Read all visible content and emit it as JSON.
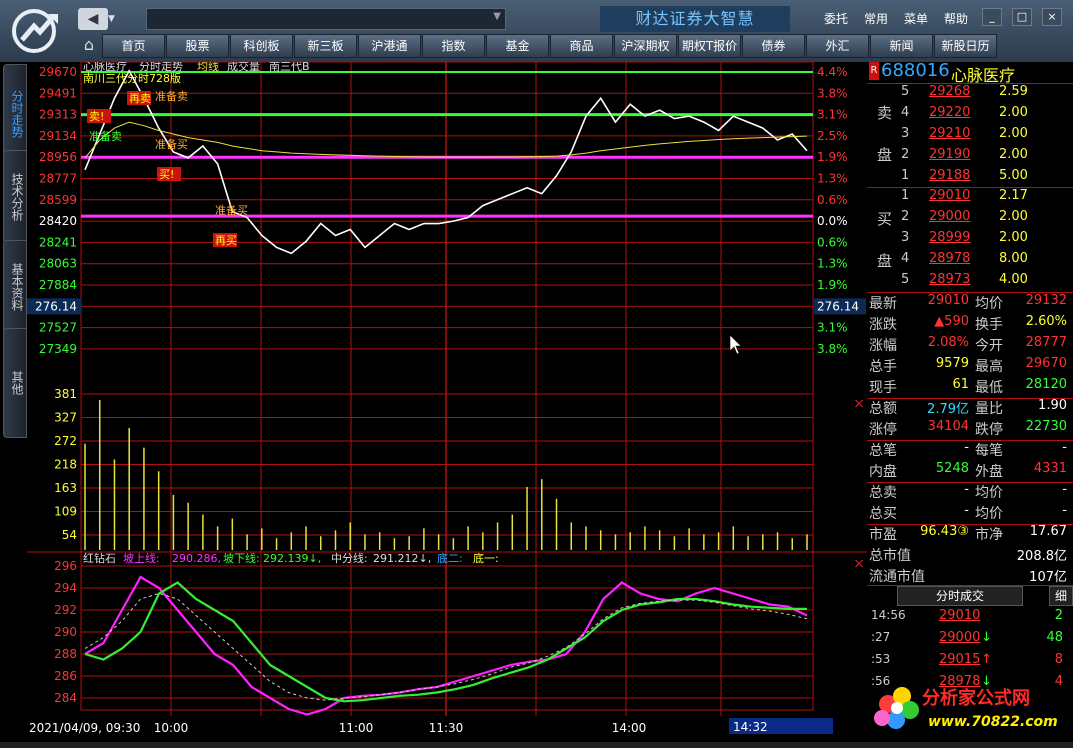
{
  "app": {
    "name": "财达证券大智慧",
    "menu": [
      "委托",
      "常用",
      "菜单",
      "帮助"
    ],
    "nav_tabs": [
      "首页",
      "股票",
      "科创板",
      "新三板",
      "沪港通",
      "指数",
      "基金",
      "商品",
      "沪深期权",
      "期权T报价",
      "债券",
      "外汇",
      "新闻",
      "新股日历"
    ],
    "window_buttons": [
      "_",
      "□",
      "×"
    ],
    "back_arrow": "◀",
    "home_icon": "⌂"
  },
  "left_tabs": [
    "分时走势",
    "技术分析",
    "基本资料",
    "其他"
  ],
  "chart": {
    "header": [
      "心脉医疗",
      "分时走势",
      "均线",
      "成交量",
      "南三代B"
    ],
    "legend_line2": "南川三代分时728版",
    "price_ticks": [
      "29670",
      "29491",
      "29313",
      "29134",
      "28956",
      "28777",
      "28599",
      "28420",
      "28241",
      "28063",
      "27884",
      "276.14",
      "27527",
      "27349"
    ],
    "pct_ticks": [
      "4.4%",
      "3.8%",
      "3.1%",
      "2.5%",
      "1.9%",
      "1.3%",
      "0.6%",
      "0.0%",
      "0.6%",
      "1.3%",
      "1.9%",
      "276.14",
      "3.1%",
      "3.8%"
    ],
    "volume_ticks": [
      "381",
      "327",
      "272",
      "218",
      "163",
      "109",
      "54"
    ],
    "signals": [
      "卖!",
      "准备卖",
      "再卖",
      "准备卖",
      "准备买",
      "买!",
      "准备买",
      "再买"
    ],
    "indicator_header": [
      "红钻石",
      "坡上线:",
      "290.286,",
      "坡下线:",
      "292.139↓,",
      "中分线:",
      "291.212↓,",
      "底二:",
      "底一:"
    ],
    "indicator_ticks": [
      "296",
      "294",
      "292",
      "290",
      "288",
      "286",
      "284"
    ],
    "time_labels": [
      "2021/04/09, 09:30",
      "10:00",
      "11:00",
      "11:30",
      "14:00"
    ],
    "time_cursor": "14:32",
    "cross_marker": "×"
  },
  "chart_data": {
    "type": "line",
    "title": "分时走势",
    "ylim": [
      27349,
      29670
    ],
    "series": [
      {
        "name": "price",
        "values": [
          28850,
          29150,
          29450,
          29680,
          29450,
          29200,
          29000,
          28950,
          29050,
          28900,
          28500,
          28450,
          28300,
          28200,
          28150,
          28250,
          28400,
          28300,
          28350,
          28200,
          28300,
          28400,
          28350,
          28400,
          28400,
          28420,
          28450,
          28550,
          28600,
          28650,
          28700,
          28650,
          28800,
          29000,
          29300,
          29450,
          29250,
          29400,
          29300,
          29350,
          29280,
          29300,
          29250,
          29180,
          29300,
          29250,
          29200,
          29100,
          29150,
          29010
        ]
      },
      {
        "name": "均线",
        "values": [
          28950,
          29100,
          29200,
          29250,
          29220,
          29180,
          29150,
          29120,
          29100,
          29080,
          29050,
          29030,
          29010,
          29000,
          28990,
          28985,
          28980,
          28975,
          28972,
          28968,
          28965,
          28962,
          28960,
          28958,
          28957,
          28956,
          28956,
          28956,
          28957,
          28958,
          28960,
          28962,
          28965,
          28975,
          28990,
          29010,
          29025,
          29040,
          29055,
          29068,
          29078,
          29088,
          29096,
          29104,
          29110,
          29116,
          29120,
          29124,
          29128,
          29132
        ]
      }
    ],
    "volume_ylim": [
      0,
      381
    ],
    "volume": [
      270,
      381,
      230,
      310,
      260,
      200,
      140,
      120,
      90,
      60,
      80,
      40,
      55,
      30,
      45,
      60,
      35,
      50,
      70,
      40,
      45,
      30,
      35,
      55,
      40,
      30,
      60,
      45,
      70,
      90,
      160,
      180,
      130,
      70,
      60,
      50,
      40,
      45,
      60,
      50,
      35,
      55,
      40,
      45,
      60,
      35,
      40,
      45,
      30,
      40
    ],
    "indicator_ylim": [
      282,
      297
    ],
    "indicator_series": [
      {
        "name": "坡上线",
        "values": [
          288,
          289,
          292,
          295,
          294,
          292,
          290,
          288,
          287,
          285,
          284,
          283,
          282.5,
          283,
          284,
          284.2,
          284.3,
          284.5,
          284.8,
          285,
          285.5,
          286,
          286.5,
          287,
          287.3,
          287.5,
          288,
          290,
          293,
          294.5,
          293.5,
          293,
          292.8,
          293.5,
          294,
          293.5,
          293,
          292.5,
          292.3,
          291.5
        ],
        "color": "#ff22ff"
      },
      {
        "name": "坡下线",
        "values": [
          288,
          287.5,
          288.5,
          290,
          293.5,
          294.5,
          293,
          292,
          291,
          289,
          287,
          286,
          285,
          284,
          283.7,
          283.8,
          284,
          284.2,
          284.3,
          284.5,
          284.8,
          285.2,
          285.8,
          286.3,
          286.8,
          287.5,
          288.5,
          289.5,
          291,
          292,
          292.5,
          292.7,
          293,
          293,
          292.8,
          292.5,
          292.3,
          292.2,
          292.1,
          292.1
        ],
        "color": "#33ee33"
      },
      {
        "name": "中分线",
        "values": [
          288.5,
          289.5,
          291,
          293,
          293.5,
          293,
          291.5,
          290,
          288.5,
          287,
          285.5,
          284.5,
          284,
          283.8,
          284,
          284.1,
          284.3,
          284.5,
          284.8,
          285,
          285.3,
          285.7,
          286.2,
          286.8,
          287.2,
          287.8,
          288.6,
          289.8,
          291.2,
          292.2,
          292.6,
          292.8,
          292.9,
          292.9,
          292.7,
          292.4,
          292.1,
          291.9,
          291.6,
          291.2
        ],
        "color": "#cccccc"
      }
    ],
    "ref_lines": {
      "upper_green": 29670,
      "mid_green": 29313,
      "magenta_1": 28956,
      "magenta_2": 28420
    }
  },
  "quote": {
    "code": "688016",
    "name": "心脉医疗",
    "flag": "R",
    "sell_label": [
      "卖",
      "盘"
    ],
    "buy_label": [
      "买",
      "盘"
    ],
    "asks": [
      {
        "lvl": "5",
        "price": "29268",
        "vol": "2.59"
      },
      {
        "lvl": "4",
        "price": "29220",
        "vol": "2.00"
      },
      {
        "lvl": "3",
        "price": "29210",
        "vol": "2.00"
      },
      {
        "lvl": "2",
        "price": "29190",
        "vol": "2.00"
      },
      {
        "lvl": "1",
        "price": "29188",
        "vol": "5.00"
      }
    ],
    "bids": [
      {
        "lvl": "1",
        "price": "29010",
        "vol": "2.17"
      },
      {
        "lvl": "2",
        "price": "29000",
        "vol": "2.00"
      },
      {
        "lvl": "3",
        "price": "28999",
        "vol": "2.00"
      },
      {
        "lvl": "4",
        "price": "28978",
        "vol": "8.00"
      },
      {
        "lvl": "5",
        "price": "28973",
        "vol": "4.00"
      }
    ],
    "stats": [
      {
        "k1": "最新",
        "v1": "29010",
        "c1": "red",
        "k2": "均价",
        "v2": "29132",
        "c2": "red"
      },
      {
        "k1": "涨跌",
        "v1": "▲590",
        "c1": "red",
        "k2": "换手",
        "v2": "2.60%",
        "c2": "yel"
      },
      {
        "k1": "涨幅",
        "v1": "2.08%",
        "c1": "red",
        "k2": "今开",
        "v2": "28777",
        "c2": "red"
      },
      {
        "k1": "总手",
        "v1": "9579",
        "c1": "yel",
        "k2": "最高",
        "v2": "29670",
        "c2": "red"
      },
      {
        "k1": "现手",
        "v1": "61",
        "c1": "yel",
        "k2": "最低",
        "v2": "28120",
        "c2": "grn"
      },
      {
        "k1": "总额",
        "v1": "2.79亿",
        "c1": "cyan",
        "k2": "量比",
        "v2": "1.90",
        "c2": "wht"
      },
      {
        "k1": "涨停",
        "v1": "34104",
        "c1": "red",
        "k2": "跌停",
        "v2": "22730",
        "c2": "grn"
      },
      {
        "k1": "总笔",
        "v1": "-",
        "c1": "wht",
        "k2": "每笔",
        "v2": "-",
        "c2": "wht"
      },
      {
        "k1": "内盘",
        "v1": "5248",
        "c1": "grn",
        "k2": "外盘",
        "v2": "4331",
        "c2": "red"
      },
      {
        "k1": "总卖",
        "v1": "-",
        "c1": "wht",
        "k2": "均价",
        "v2": "-",
        "c2": "wht"
      },
      {
        "k1": "总买",
        "v1": "-",
        "c1": "wht",
        "k2": "均价",
        "v2": "-",
        "c2": "wht"
      },
      {
        "k1": "市盈",
        "v1": "96.43③",
        "c1": "yel",
        "k2": "市净",
        "v2": "17.67",
        "c2": "wht"
      }
    ],
    "market_cap": {
      "label": "总市值",
      "value": "208.8亿"
    },
    "float_cap": {
      "label": "流通市值",
      "value": "107亿"
    },
    "trade_tabs": [
      "分时成交",
      "细"
    ],
    "trades": [
      {
        "time": "14:56",
        "price": "29010",
        "dir": "",
        "vol": "2"
      },
      {
        "time": ":27",
        "price": "29000",
        "dir": "↓",
        "vol": "48"
      },
      {
        "time": ":53",
        "price": "29015",
        "dir": "↑",
        "vol": "8"
      },
      {
        "time": ":56",
        "price": "28978",
        "dir": "↓",
        "vol": "4"
      }
    ]
  },
  "watermark": {
    "title": "分析家公式网",
    "url": "www.70822.com"
  }
}
